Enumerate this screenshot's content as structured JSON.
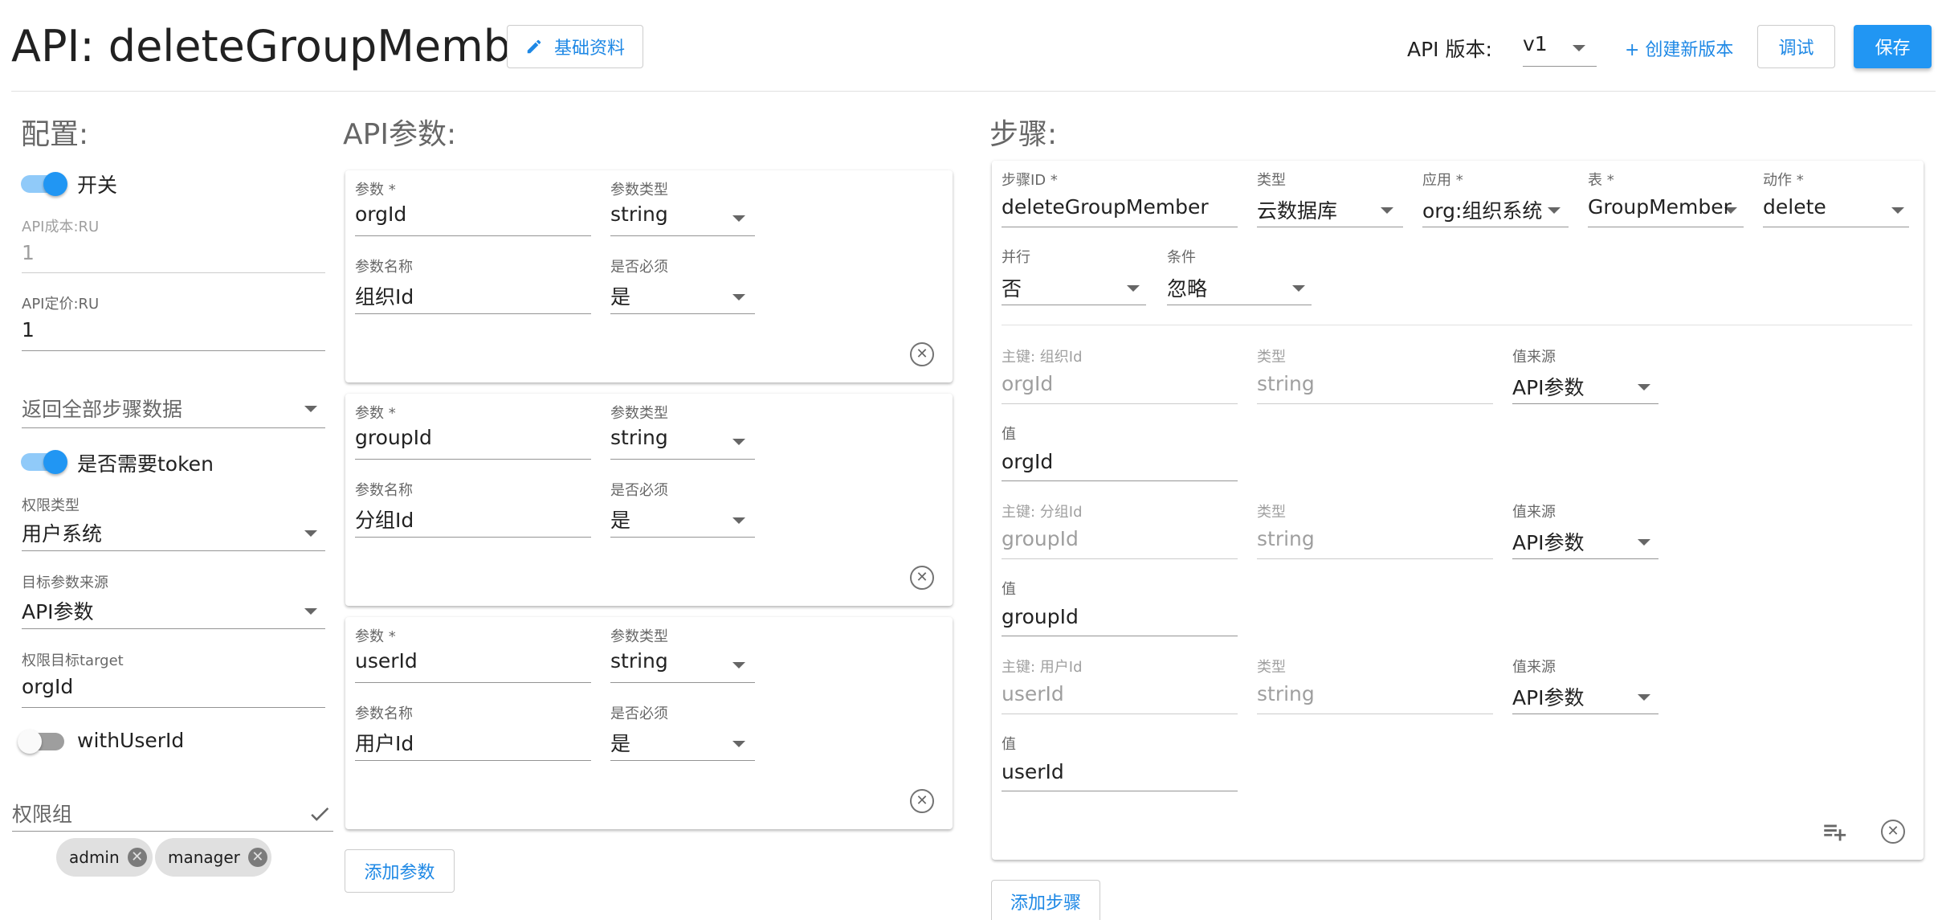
{
  "header": {
    "title": "API: deleteGroupMember",
    "basic_info_label": "基础资料",
    "version_label": "API 版本:",
    "version_value": "v1",
    "create_version_label": "+ 创建新版本",
    "debug_label": "调试",
    "save_label": "保存"
  },
  "config": {
    "title": "配置:",
    "switch_label": "开关",
    "switch_on": true,
    "cost_label": "API成本:RU",
    "cost_value": "1",
    "price_label": "API定价:RU",
    "price_value": "1",
    "return_all_placeholder": "返回全部步骤数据",
    "token_label": "是否需要token",
    "token_on": true,
    "perm_type_label": "权限类型",
    "perm_type_value": "用户系统",
    "target_source_label": "目标参数来源",
    "target_source_value": "API参数",
    "perm_target_label": "权限目标target",
    "perm_target_value": "orgId",
    "with_user_label": "withUserId",
    "with_user_on": false,
    "perm_group_label": "权限组",
    "perm_group_chips": [
      "admin",
      "manager"
    ]
  },
  "params": {
    "title": "API参数:",
    "param_label": "参数",
    "param_type_label": "参数类型",
    "param_name_label": "参数名称",
    "required_label": "是否必须",
    "items": [
      {
        "param": "orgId",
        "type": "string",
        "name": "组织Id",
        "required": "是"
      },
      {
        "param": "groupId",
        "type": "string",
        "name": "分组Id",
        "required": "是"
      },
      {
        "param": "userId",
        "type": "string",
        "name": "用户Id",
        "required": "是"
      }
    ],
    "add_label": "添加参数"
  },
  "steps": {
    "title": "步骤:",
    "step_id_label": "步骤ID",
    "step_id_value": "deleteGroupMember",
    "type_label": "类型",
    "type_value": "云数据库",
    "app_label": "应用",
    "app_value": "org:组织系统",
    "table_label": "表",
    "table_value": "GroupMember",
    "action_label": "动作",
    "action_value": "delete",
    "parallel_label": "并行",
    "parallel_value": "否",
    "condition_label": "条件",
    "condition_value": "忽略",
    "key_type_label": "类型",
    "source_label": "值来源",
    "value_label": "值",
    "keys": [
      {
        "key_label": "主键: 组织Id",
        "key_value": "orgId",
        "type": "string",
        "source": "API参数",
        "value": "orgId"
      },
      {
        "key_label": "主键: 分组Id",
        "key_value": "groupId",
        "type": "string",
        "source": "API参数",
        "value": "groupId"
      },
      {
        "key_label": "主键: 用户Id",
        "key_value": "userId",
        "type": "string",
        "source": "API参数",
        "value": "userId"
      }
    ],
    "add_label": "添加步骤"
  },
  "colors": {
    "primary": "#2196f3",
    "accent_text": "#1e88e5",
    "toggle_on_track": "#90caf9",
    "toggle_off_track": "#9e9e9e"
  }
}
